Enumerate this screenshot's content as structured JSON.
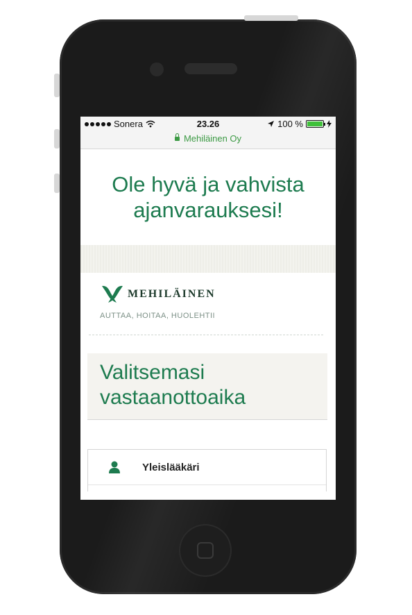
{
  "status_bar": {
    "carrier": "Sonera",
    "time": "23.26",
    "battery": "100 %",
    "site_owner": "Mehiläinen Oy"
  },
  "page": {
    "heading_line1": "Ole hyvä ja vahvista",
    "heading_line2": "ajanvarauksesi!",
    "brand_name": "MEHILÄINEN",
    "tagline": "AUTTAA, HOITAA, HUOLEHTII",
    "section_title_line1": "Valitsemasi",
    "section_title_line2": "vastaanottoaika",
    "doctor_type": "Yleislääkäri"
  },
  "colors": {
    "brand_green": "#1d7b4f",
    "secure_green": "#3c9a44",
    "phone_body": "#1b1b1b"
  },
  "icons": {
    "signal": "signal-dots-icon",
    "wifi": "wifi-icon",
    "location": "location-arrow-icon",
    "battery": "battery-icon",
    "charging": "charging-bolt-icon",
    "lock": "lock-icon",
    "logo": "mehilainen-logo",
    "person": "person-icon"
  }
}
